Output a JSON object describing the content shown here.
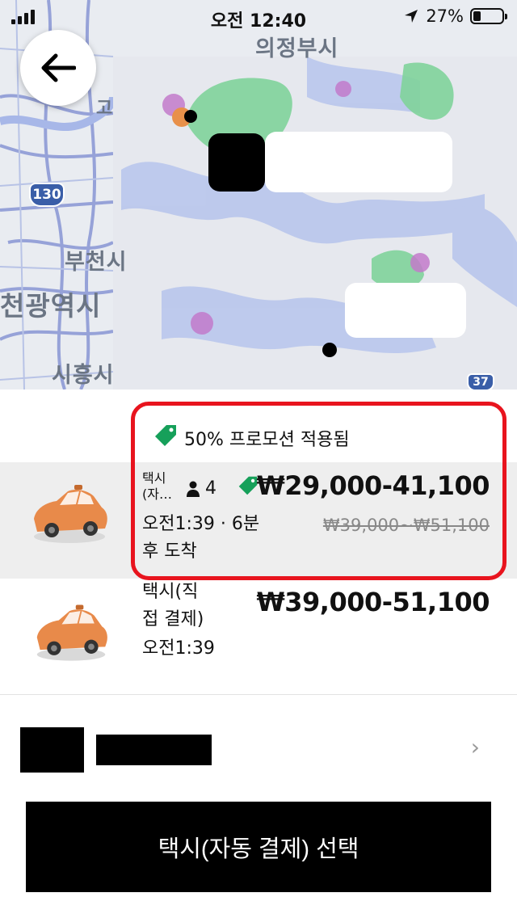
{
  "status_bar": {
    "time": "오전 12:40",
    "battery_percent": "27%",
    "battery_level": 0.27,
    "signal_icon": "signal-bars-icon",
    "location_icon": "location-arrow-icon"
  },
  "map": {
    "back_icon": "arrow-left-icon",
    "labels": {
      "uijeongbu": "의정부시",
      "bucheon": "부천시",
      "incheon": "천광역시",
      "siheung": "시흥시",
      "go": "고"
    },
    "route_130": "130",
    "route_37": "37"
  },
  "promo": {
    "icon": "tag-icon",
    "text": "50% 프로모션 적용됨"
  },
  "options": [
    {
      "name": "택시\n(자…",
      "capacity_icon": "person-icon",
      "capacity": "4",
      "promo_icon": "tag-icon",
      "price": "₩29,000-41,100",
      "eta": "오전1:39 · 6분\n후 도착",
      "original_price": "₩39,000~₩51,100",
      "image": "taxi-car-icon"
    },
    {
      "name": "택시(직\n접 결제)",
      "price": "₩39,000-51,100",
      "eta": "오전1:39",
      "image": "taxi-car-icon"
    }
  ],
  "payment": {
    "chevron_icon": "chevron-right-icon",
    "chevron": "›"
  },
  "select_button": {
    "label": "택시(자동 결제) 선택"
  },
  "colors": {
    "highlight": "#e8141e",
    "promo_tag": "#16a05a",
    "taxi": "#e88a4a",
    "button": "#000000"
  }
}
